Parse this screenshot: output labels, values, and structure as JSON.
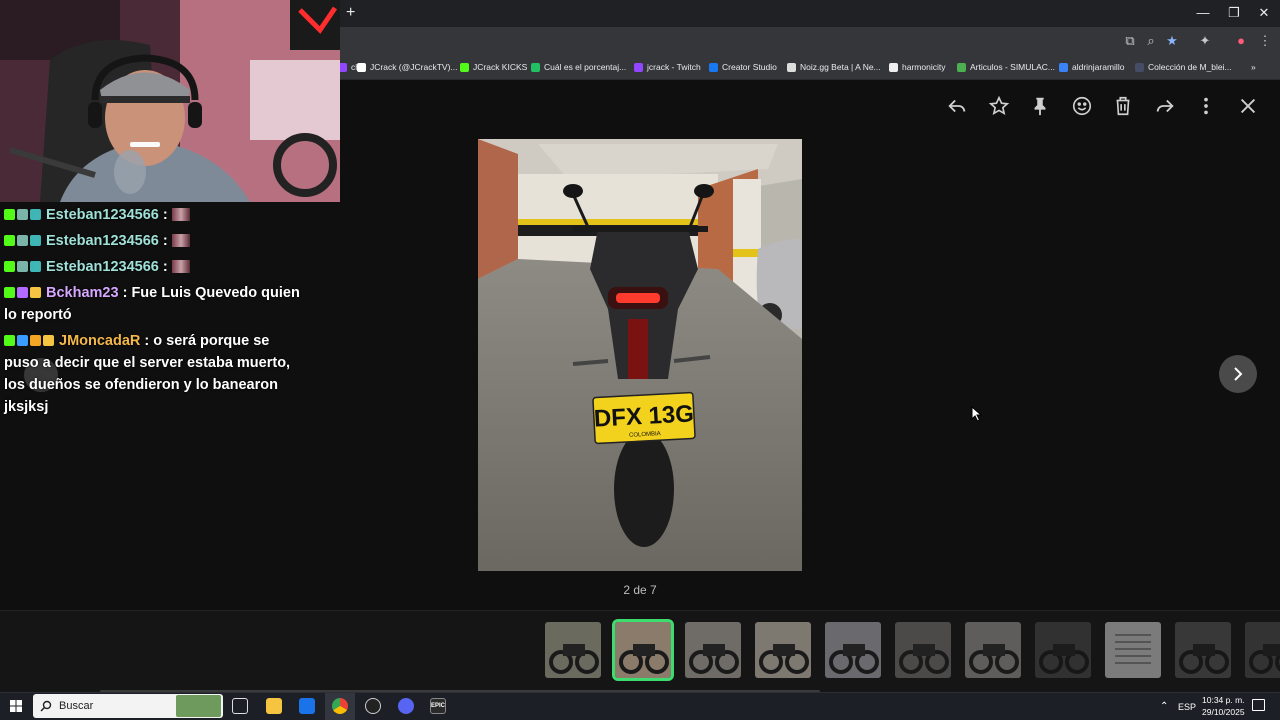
{
  "browser": {
    "new_tab_symbol": "+",
    "window_controls": [
      "—",
      "❐",
      "✕"
    ],
    "bookmarks": [
      {
        "label": "ch",
        "color": "#9146ff"
      },
      {
        "label": "JCrack (@JCrackTV)...",
        "color": "#ffffff"
      },
      {
        "label": "JCrack KICKS",
        "color": "#53fc18"
      },
      {
        "label": "Cuál es el porcentaj...",
        "color": "#21c063"
      },
      {
        "label": "jcrack - Twitch",
        "color": "#9146ff"
      },
      {
        "label": "Creator Studio",
        "color": "#1877f2"
      },
      {
        "label": "Noiz.gg Beta | A Ne...",
        "color": "#dddddd"
      },
      {
        "label": "harmonicity",
        "color": "#eeeeee"
      },
      {
        "label": "Articulos - SIMULAC...",
        "color": "#4caf50"
      },
      {
        "label": "aldrinjaramillo",
        "color": "#3b82f6"
      },
      {
        "label": "Colección de M_blei...",
        "color": "#444c66"
      }
    ],
    "more_bookmarks_symbol": "»"
  },
  "viewer": {
    "actions": [
      "reply-icon",
      "star-icon",
      "pin-icon",
      "emoji-icon",
      "trash-icon",
      "forward-icon",
      "more-icon",
      "close-icon"
    ],
    "counter": "2 de 7",
    "photo": {
      "plate_main": "DFX 13G",
      "plate_sub": "COLOMBIA"
    },
    "thumbnails_active_index": 1,
    "thumbnail_count": 11
  },
  "chat": {
    "messages": [
      {
        "user": "Esteban1234566",
        "sep": " : ",
        "text": "",
        "user_color": "#9fe0d8"
      },
      {
        "user": "Esteban1234566",
        "sep": " : ",
        "text": "",
        "user_color": "#9fe0d8"
      },
      {
        "user": "Esteban1234566",
        "sep": " : ",
        "text": "",
        "user_color": "#9fe0d8"
      },
      {
        "user": "Bckham23",
        "sep": " : ",
        "text": "Fue Luis Quevedo quien lo reportó",
        "user_color": "#d6a8ff"
      },
      {
        "user": "JMoncadaR",
        "sep": " : ",
        "text": "o será porque se puso a decir que el server estaba muerto, los dueños se ofendieron y lo banearon jksjksj",
        "user_color": "#f5b84a"
      }
    ]
  },
  "taskbar": {
    "search_placeholder": "Buscar",
    "language": "ESP",
    "time": "10:34 p. m.",
    "date": "29/10/2025",
    "epic_label": "EPIC"
  }
}
